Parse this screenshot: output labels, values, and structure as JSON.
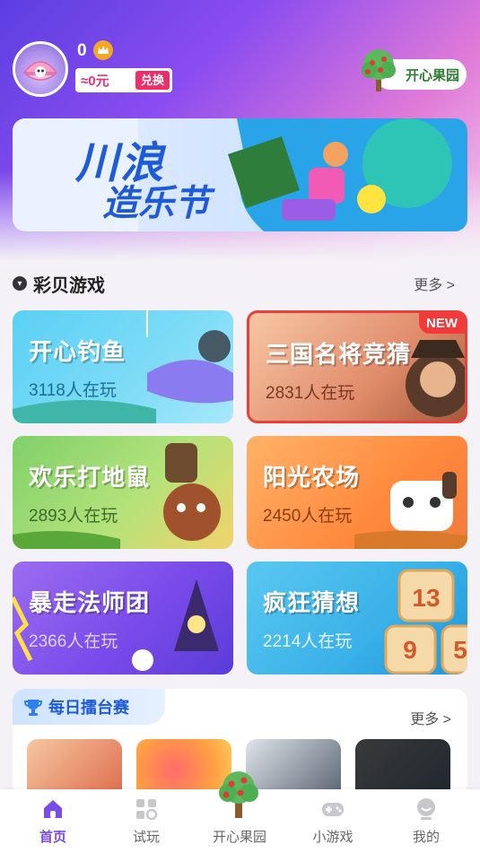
{
  "header": {
    "coins": "0",
    "cash": "≈0元",
    "exchange_label": "兑换",
    "orchard_label": "开心果园"
  },
  "section": {
    "title": "彩贝游戏",
    "more": "更多 >"
  },
  "banner": {
    "title": "川浪",
    "subtitle": "造乐节"
  },
  "games": [
    {
      "name": "开心钓鱼",
      "players": "3118人在玩"
    },
    {
      "name": "三国名将竞猜",
      "players": "2831人在玩",
      "badge": "NEW"
    },
    {
      "name": "欢乐打地鼠",
      "players": "2893人在玩"
    },
    {
      "name": "阳光农场",
      "players": "2450人在玩"
    },
    {
      "name": "暴走法师团",
      "players": "2366人在玩"
    },
    {
      "name": "疯狂猜想",
      "players": "2214人在玩"
    }
  ],
  "arena": {
    "title": "每日擂台赛",
    "more": "更多 >"
  },
  "tabs": [
    {
      "label": "首页"
    },
    {
      "label": "试玩"
    },
    {
      "label": "开心果园"
    },
    {
      "label": "小游戏"
    },
    {
      "label": "我的"
    }
  ],
  "colors": {
    "accent": "#7a4bea",
    "exchange": "#ec2f6b",
    "new_badge": "#f23a3a"
  }
}
